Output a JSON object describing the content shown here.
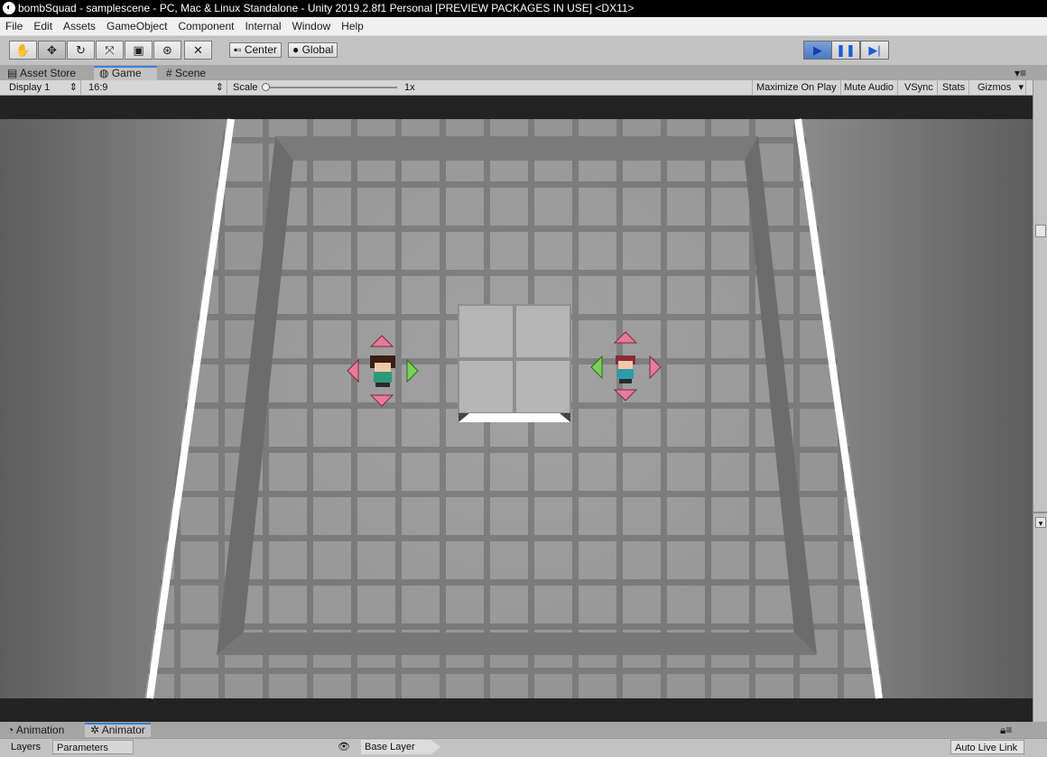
{
  "window": {
    "title": "bombSquad - samplescene - PC, Mac & Linux Standalone - Unity 2019.2.8f1 Personal [PREVIEW PACKAGES IN USE] <DX11>"
  },
  "menu": [
    "File",
    "Edit",
    "Assets",
    "GameObject",
    "Component",
    "Internal",
    "Window",
    "Help"
  ],
  "toolbar": {
    "pivot_label": "Center",
    "space_label": "Global"
  },
  "tabs": {
    "asset_store": "Asset Store",
    "game": "Game",
    "scene": "Scene"
  },
  "game_toolbar": {
    "display": "Display 1",
    "aspect": "16:9",
    "scale_label": "Scale",
    "scale_value": "1x",
    "maximize": "Maximize On Play",
    "mute": "Mute Audio",
    "vsync": "VSync",
    "stats": "Stats",
    "gizmos": "Gizmos"
  },
  "bottom": {
    "animation_tab": "Animation",
    "animator_tab": "Animator",
    "layers": "Layers",
    "parameters": "Parameters",
    "base_layer": "Base Layer",
    "auto_live_link": "Auto Live Link"
  },
  "colors": {
    "play_active": "#4a7ac4",
    "arrow_pink": "#e87a9a",
    "arrow_green": "#7ad05a"
  }
}
